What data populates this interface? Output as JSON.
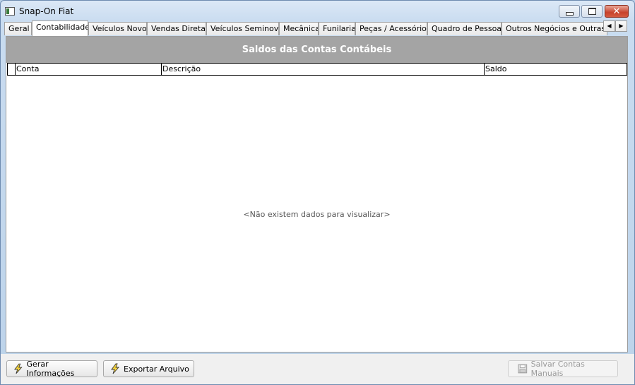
{
  "window": {
    "title": "Snap-On Fiat"
  },
  "tabs": [
    {
      "label": "Geral"
    },
    {
      "label": "Contabilidade"
    },
    {
      "label": "Veículos Novos"
    },
    {
      "label": "Vendas Diretas"
    },
    {
      "label": "Veículos Seminovos"
    },
    {
      "label": "Mecânica"
    },
    {
      "label": "Funilaria"
    },
    {
      "label": "Peças / Acessórios"
    },
    {
      "label": "Quadro de Pessoas"
    },
    {
      "label": "Outros Negócios e Outras Margens"
    }
  ],
  "active_tab": "Contabilidade",
  "grid": {
    "title": "Saldos das Contas Contábeis",
    "columns": [
      "Conta",
      "Descrição",
      "Saldo"
    ],
    "rows": [],
    "empty_message": "<Não existem dados para visualizar>"
  },
  "buttons": {
    "generate": "Gerar Informações",
    "export": "Exportar Arquivo",
    "save_manual": "Salvar Contas Manuais"
  },
  "icons": {
    "app": "app-window-icon",
    "generate": "lightning-bolt-icon",
    "export": "lightning-bolt-icon",
    "save": "floppy-disk-icon"
  },
  "colors": {
    "grid_header_bg": "#a4a4a4",
    "window_frame": "#bcd3ea",
    "close_button": "#c7432d"
  }
}
